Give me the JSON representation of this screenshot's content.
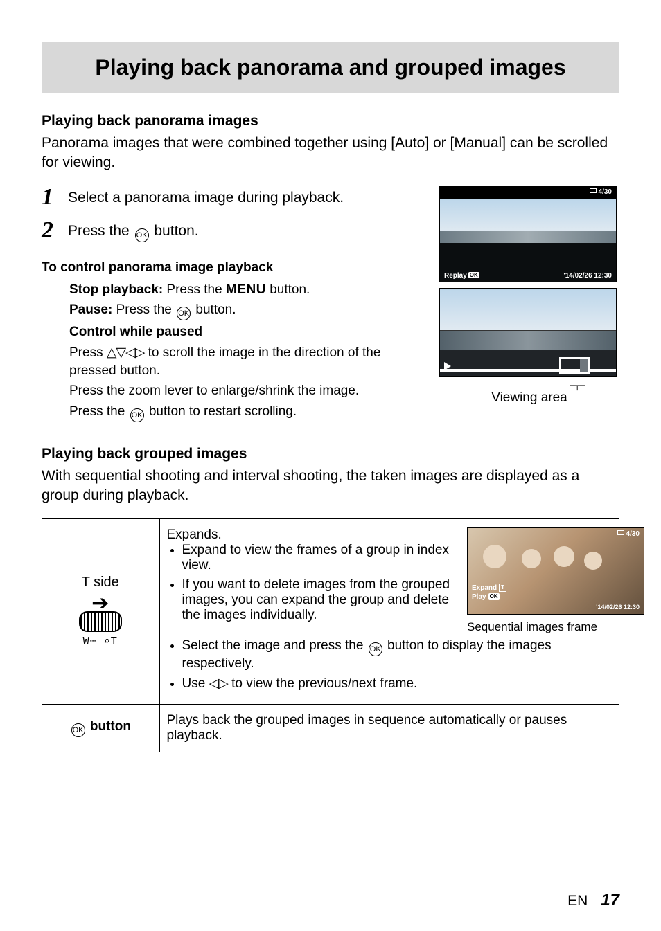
{
  "title": "Playing back panorama and grouped images",
  "pano": {
    "heading": "Playing back panorama images",
    "intro": "Panorama images that were combined together using [Auto] or [Manual] can be scrolled for viewing.",
    "step1": "Select a panorama image during playback.",
    "step2a": "Press the ",
    "step2b": " button.",
    "control_h": "To control panorama image playback",
    "stop_label": "Stop playback:",
    "stop_text": " Press the ",
    "menu_kw": "MENU",
    "stop_text2": " button.",
    "pause_label": "Pause:",
    "pause_text": " Press the ",
    "pause_text2": " button.",
    "cwp": "Control while paused",
    "scroll_a": "Press ",
    "scroll_b": " to scroll the image in the direction of the pressed button.",
    "zoom": "Press the zoom lever to enlarge/shrink the image.",
    "restart_a": "Press the ",
    "restart_b": " button to restart scrolling.",
    "thumb_counter": "4/30",
    "thumb_replay": "Replay",
    "thumb_date": "'14/02/26 12:30",
    "viewing_area": "Viewing area"
  },
  "group": {
    "heading": "Playing back grouped images",
    "intro": "With sequential shooting and interval shooting, the taken images are displayed as a group during playback.",
    "tside_lab": "T side",
    "scale": "W┄ ⌕T",
    "expands": "Expands.",
    "b1": "Expand to view the frames of a group in index view.",
    "b2": "If you want to delete images from the grouped images, you can expand the group and delete the images individually.",
    "b3a": "Select the image and press the ",
    "b3b": " button to display the images respectively.",
    "b4a": "Use ",
    "b4b": " to view the previous/next frame.",
    "okrow_lab": " button",
    "okrow_text": "Plays back the grouped images in sequence automatically or pauses playback.",
    "seq_thumb": {
      "counter": "4/30",
      "expand": "Expand",
      "play": "Play",
      "date": "'14/02/26 12:30",
      "caption": "Sequential images frame"
    }
  },
  "footer": {
    "lang": "EN",
    "page": "17"
  }
}
